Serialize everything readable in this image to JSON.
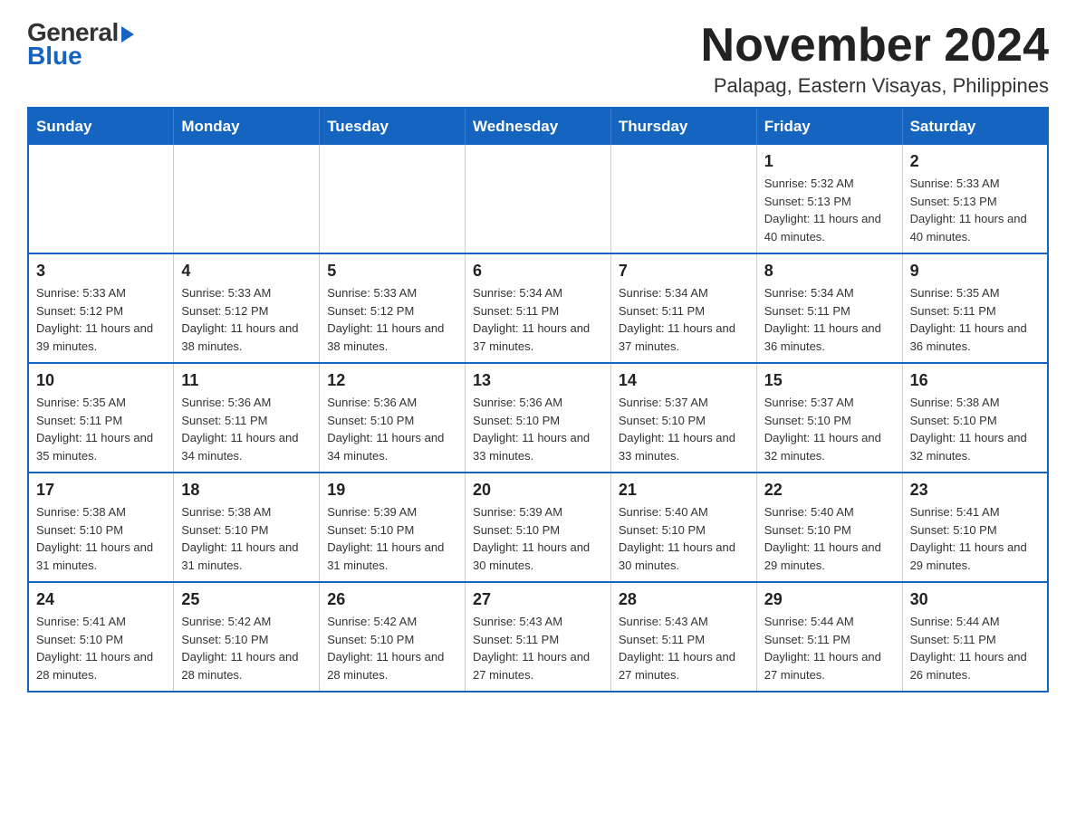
{
  "header": {
    "logo_general": "General",
    "logo_blue": "Blue",
    "month_title": "November 2024",
    "location": "Palapag, Eastern Visayas, Philippines"
  },
  "days_of_week": [
    "Sunday",
    "Monday",
    "Tuesday",
    "Wednesday",
    "Thursday",
    "Friday",
    "Saturday"
  ],
  "weeks": [
    [
      {
        "day": "",
        "info": ""
      },
      {
        "day": "",
        "info": ""
      },
      {
        "day": "",
        "info": ""
      },
      {
        "day": "",
        "info": ""
      },
      {
        "day": "",
        "info": ""
      },
      {
        "day": "1",
        "info": "Sunrise: 5:32 AM\nSunset: 5:13 PM\nDaylight: 11 hours and 40 minutes."
      },
      {
        "day": "2",
        "info": "Sunrise: 5:33 AM\nSunset: 5:13 PM\nDaylight: 11 hours and 40 minutes."
      }
    ],
    [
      {
        "day": "3",
        "info": "Sunrise: 5:33 AM\nSunset: 5:12 PM\nDaylight: 11 hours and 39 minutes."
      },
      {
        "day": "4",
        "info": "Sunrise: 5:33 AM\nSunset: 5:12 PM\nDaylight: 11 hours and 38 minutes."
      },
      {
        "day": "5",
        "info": "Sunrise: 5:33 AM\nSunset: 5:12 PM\nDaylight: 11 hours and 38 minutes."
      },
      {
        "day": "6",
        "info": "Sunrise: 5:34 AM\nSunset: 5:11 PM\nDaylight: 11 hours and 37 minutes."
      },
      {
        "day": "7",
        "info": "Sunrise: 5:34 AM\nSunset: 5:11 PM\nDaylight: 11 hours and 37 minutes."
      },
      {
        "day": "8",
        "info": "Sunrise: 5:34 AM\nSunset: 5:11 PM\nDaylight: 11 hours and 36 minutes."
      },
      {
        "day": "9",
        "info": "Sunrise: 5:35 AM\nSunset: 5:11 PM\nDaylight: 11 hours and 36 minutes."
      }
    ],
    [
      {
        "day": "10",
        "info": "Sunrise: 5:35 AM\nSunset: 5:11 PM\nDaylight: 11 hours and 35 minutes."
      },
      {
        "day": "11",
        "info": "Sunrise: 5:36 AM\nSunset: 5:11 PM\nDaylight: 11 hours and 34 minutes."
      },
      {
        "day": "12",
        "info": "Sunrise: 5:36 AM\nSunset: 5:10 PM\nDaylight: 11 hours and 34 minutes."
      },
      {
        "day": "13",
        "info": "Sunrise: 5:36 AM\nSunset: 5:10 PM\nDaylight: 11 hours and 33 minutes."
      },
      {
        "day": "14",
        "info": "Sunrise: 5:37 AM\nSunset: 5:10 PM\nDaylight: 11 hours and 33 minutes."
      },
      {
        "day": "15",
        "info": "Sunrise: 5:37 AM\nSunset: 5:10 PM\nDaylight: 11 hours and 32 minutes."
      },
      {
        "day": "16",
        "info": "Sunrise: 5:38 AM\nSunset: 5:10 PM\nDaylight: 11 hours and 32 minutes."
      }
    ],
    [
      {
        "day": "17",
        "info": "Sunrise: 5:38 AM\nSunset: 5:10 PM\nDaylight: 11 hours and 31 minutes."
      },
      {
        "day": "18",
        "info": "Sunrise: 5:38 AM\nSunset: 5:10 PM\nDaylight: 11 hours and 31 minutes."
      },
      {
        "day": "19",
        "info": "Sunrise: 5:39 AM\nSunset: 5:10 PM\nDaylight: 11 hours and 31 minutes."
      },
      {
        "day": "20",
        "info": "Sunrise: 5:39 AM\nSunset: 5:10 PM\nDaylight: 11 hours and 30 minutes."
      },
      {
        "day": "21",
        "info": "Sunrise: 5:40 AM\nSunset: 5:10 PM\nDaylight: 11 hours and 30 minutes."
      },
      {
        "day": "22",
        "info": "Sunrise: 5:40 AM\nSunset: 5:10 PM\nDaylight: 11 hours and 29 minutes."
      },
      {
        "day": "23",
        "info": "Sunrise: 5:41 AM\nSunset: 5:10 PM\nDaylight: 11 hours and 29 minutes."
      }
    ],
    [
      {
        "day": "24",
        "info": "Sunrise: 5:41 AM\nSunset: 5:10 PM\nDaylight: 11 hours and 28 minutes."
      },
      {
        "day": "25",
        "info": "Sunrise: 5:42 AM\nSunset: 5:10 PM\nDaylight: 11 hours and 28 minutes."
      },
      {
        "day": "26",
        "info": "Sunrise: 5:42 AM\nSunset: 5:10 PM\nDaylight: 11 hours and 28 minutes."
      },
      {
        "day": "27",
        "info": "Sunrise: 5:43 AM\nSunset: 5:11 PM\nDaylight: 11 hours and 27 minutes."
      },
      {
        "day": "28",
        "info": "Sunrise: 5:43 AM\nSunset: 5:11 PM\nDaylight: 11 hours and 27 minutes."
      },
      {
        "day": "29",
        "info": "Sunrise: 5:44 AM\nSunset: 5:11 PM\nDaylight: 11 hours and 27 minutes."
      },
      {
        "day": "30",
        "info": "Sunrise: 5:44 AM\nSunset: 5:11 PM\nDaylight: 11 hours and 26 minutes."
      }
    ]
  ]
}
